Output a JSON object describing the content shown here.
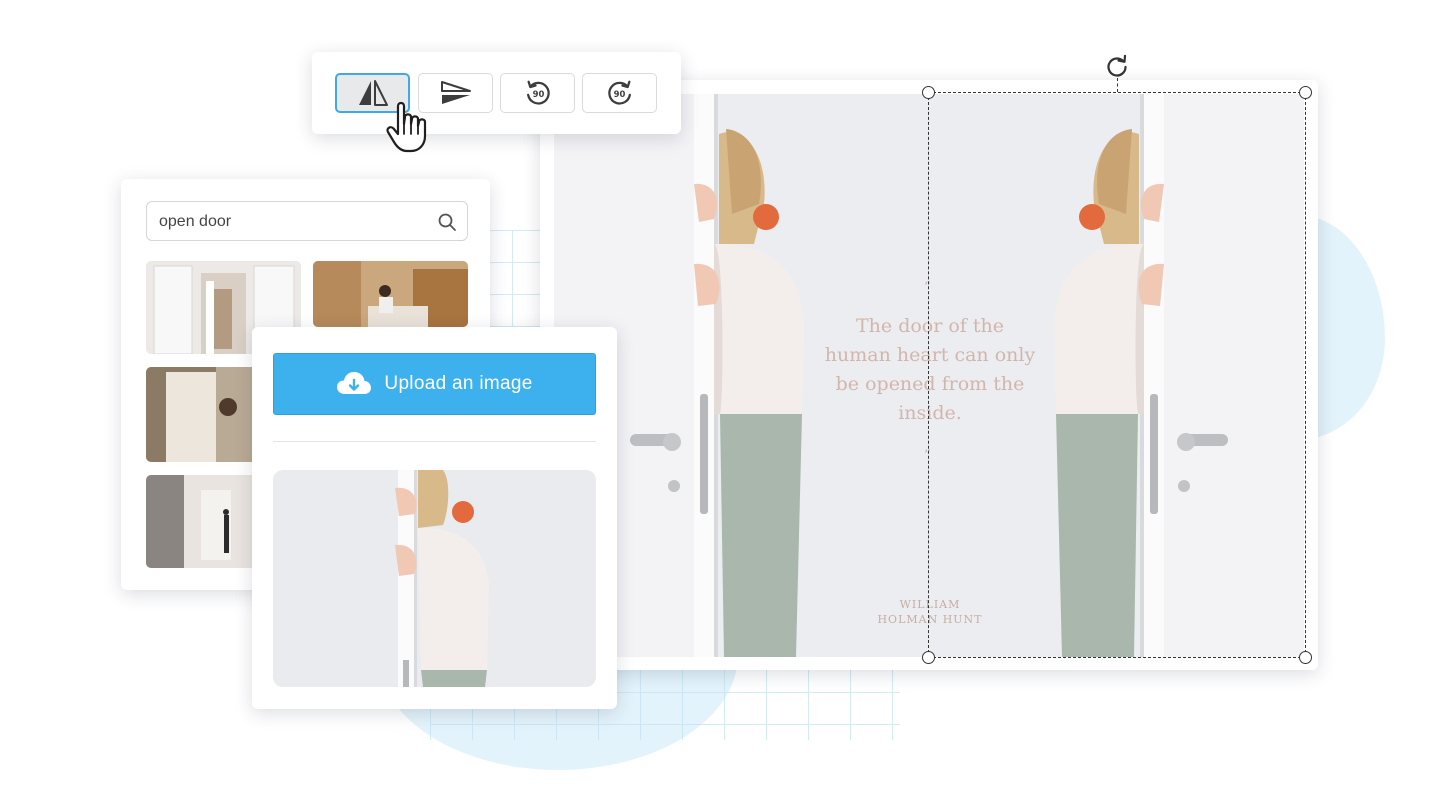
{
  "toolbar": {
    "buttons": [
      {
        "id": "flip-horizontal",
        "icon": "flip-horizontal-icon",
        "active": true
      },
      {
        "id": "flip-vertical",
        "icon": "flip-vertical-icon",
        "active": false
      },
      {
        "id": "rotate-left-90",
        "icon": "rotate-left-icon",
        "badge": "90"
      },
      {
        "id": "rotate-right-90",
        "icon": "rotate-right-icon",
        "badge": "90"
      }
    ]
  },
  "search": {
    "value": "open door",
    "icon": "search-icon"
  },
  "upload": {
    "label": "Upload an image",
    "icon": "cloud-upload-icon",
    "color": "#3cb1ee"
  },
  "canvas": {
    "quote": "The door of the human heart can only be opened from the inside.",
    "quote_mark_open": "“",
    "quote_mark_close": "”",
    "author_line1": "WILLIAM",
    "author_line2": "HOLMAN HUNT",
    "text_color": "#d2b6ac"
  },
  "colors": {
    "accent": "#41a8e6",
    "upload_button": "#3cb1ee",
    "background_blob": "#e3f3fb"
  }
}
